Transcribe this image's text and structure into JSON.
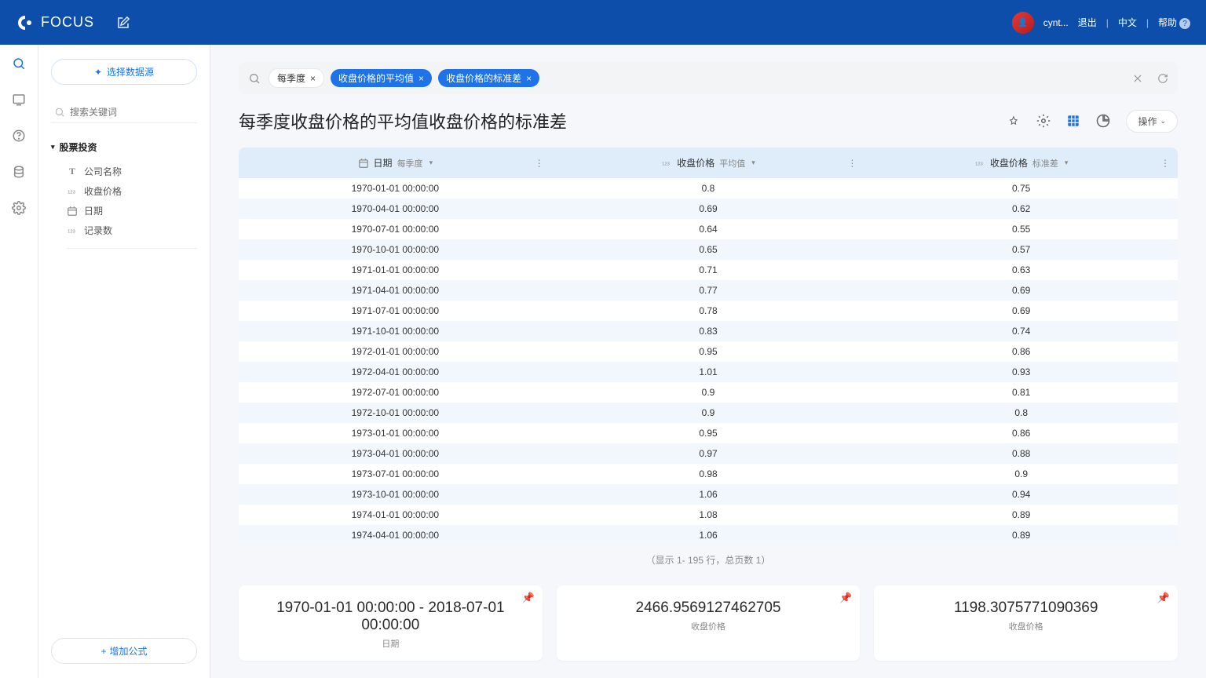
{
  "topbar": {
    "brand": "FOCUS",
    "user_short": "cynt...",
    "logout": "退出",
    "lang": "中文",
    "help": "帮助"
  },
  "sidebar": {
    "select_source": "选择数据源",
    "search_placeholder": "搜索关键词",
    "tree_root": "股票投资",
    "leaves": [
      {
        "icon": "T",
        "label": "公司名称"
      },
      {
        "icon": "123",
        "label": "收盘价格"
      },
      {
        "icon": "cal",
        "label": "日期"
      },
      {
        "icon": "123",
        "label": "记录数"
      }
    ],
    "add_formula": "增加公式"
  },
  "query": {
    "chips": [
      {
        "label": "每季度",
        "style": "plain"
      },
      {
        "label": "收盘价格的平均值",
        "style": "blue"
      },
      {
        "label": "收盘价格的标准差",
        "style": "blue"
      }
    ]
  },
  "page_title": "每季度收盘价格的平均值收盘价格的标准差",
  "ops_label": "操作",
  "table": {
    "headers": [
      {
        "icon": "cal",
        "label": "日期",
        "sub": "每季度"
      },
      {
        "icon": "123",
        "label": "收盘价格",
        "sub": "平均值"
      },
      {
        "icon": "123",
        "label": "收盘价格",
        "sub": "标准差"
      }
    ],
    "rows": [
      [
        "1970-01-01 00:00:00",
        "0.8",
        "0.75"
      ],
      [
        "1970-04-01 00:00:00",
        "0.69",
        "0.62"
      ],
      [
        "1970-07-01 00:00:00",
        "0.64",
        "0.55"
      ],
      [
        "1970-10-01 00:00:00",
        "0.65",
        "0.57"
      ],
      [
        "1971-01-01 00:00:00",
        "0.71",
        "0.63"
      ],
      [
        "1971-04-01 00:00:00",
        "0.77",
        "0.69"
      ],
      [
        "1971-07-01 00:00:00",
        "0.78",
        "0.69"
      ],
      [
        "1971-10-01 00:00:00",
        "0.83",
        "0.74"
      ],
      [
        "1972-01-01 00:00:00",
        "0.95",
        "0.86"
      ],
      [
        "1972-04-01 00:00:00",
        "1.01",
        "0.93"
      ],
      [
        "1972-07-01 00:00:00",
        "0.9",
        "0.81"
      ],
      [
        "1972-10-01 00:00:00",
        "0.9",
        "0.8"
      ],
      [
        "1973-01-01 00:00:00",
        "0.95",
        "0.86"
      ],
      [
        "1973-04-01 00:00:00",
        "0.97",
        "0.88"
      ],
      [
        "1973-07-01 00:00:00",
        "0.98",
        "0.9"
      ],
      [
        "1973-10-01 00:00:00",
        "1.06",
        "0.94"
      ],
      [
        "1974-01-01 00:00:00",
        "1.08",
        "0.89"
      ],
      [
        "1974-04-01 00:00:00",
        "1.06",
        "0.89"
      ]
    ],
    "footer": "（显示 1- 195 行，总页数 1）"
  },
  "cards": [
    {
      "value": "1970-01-01 00:00:00 - 2018-07-01 00:00:00",
      "label": "日期"
    },
    {
      "value": "2466.9569127462705",
      "label": "收盘价格"
    },
    {
      "value": "1198.3075771090369",
      "label": "收盘价格"
    }
  ]
}
